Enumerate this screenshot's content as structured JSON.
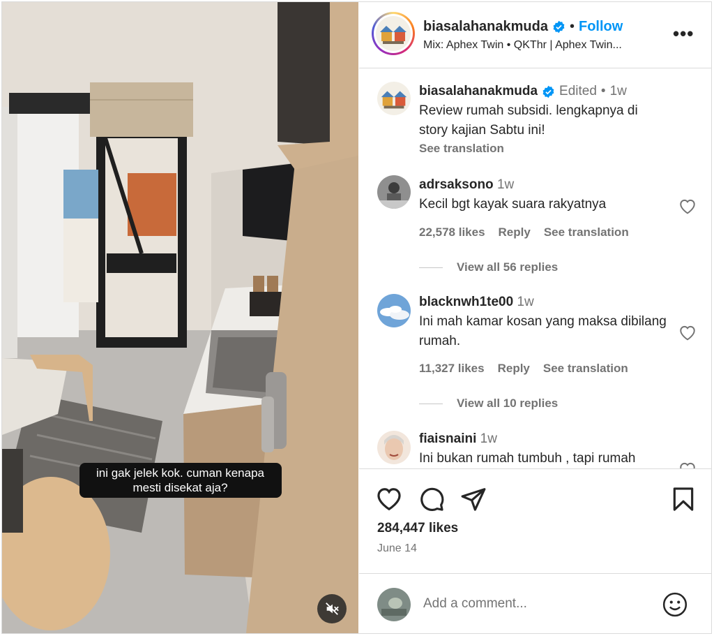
{
  "video": {
    "caption": "ini gak jelek kok. cuman kenapa mesti disekat aja?",
    "mute_icon": "volume-muted-icon"
  },
  "header": {
    "username": "biasalahanakmuda",
    "separator": "•",
    "follow_label": "Follow",
    "audio": "Mix: Aphex Twin • QKThr | Aphex Twin...",
    "more_icon": "more-horizontal-icon",
    "more_label": "•••"
  },
  "post": {
    "username": "biasalahanakmuda",
    "edited": "Edited",
    "separator": "•",
    "time": "1w",
    "caption": "Review rumah subsidi. lengkapnya di story kajian Sabtu ini!",
    "see_translation": "See translation"
  },
  "comments": [
    {
      "username": "adrsaksono",
      "time": "1w",
      "text": "Kecil bgt kayak suara rakyatnya",
      "likes": "22,578 likes",
      "reply": "Reply",
      "see_translation": "See translation",
      "view_replies": "View all 56 replies"
    },
    {
      "username": "blacknwh1te00",
      "time": "1w",
      "text": "Ini mah kamar kosan yang maksa dibilang rumah.",
      "likes": "11,327 likes",
      "reply": "Reply",
      "see_translation": "See translation",
      "view_replies": "View all 10 replies"
    },
    {
      "username": "fiaisnaini",
      "time": "1w",
      "text": "Ini bukan rumah tumbuh , tapi rumah"
    }
  ],
  "actions": {
    "likes": "284,447 likes",
    "date": "June 14"
  },
  "add_comment": {
    "placeholder": "Add a comment..."
  },
  "colors": {
    "link_blue": "#0095f6",
    "text_primary": "#262626",
    "text_secondary": "#737373",
    "border": "#dbdbdb",
    "verified_blue": "#0095f6"
  }
}
